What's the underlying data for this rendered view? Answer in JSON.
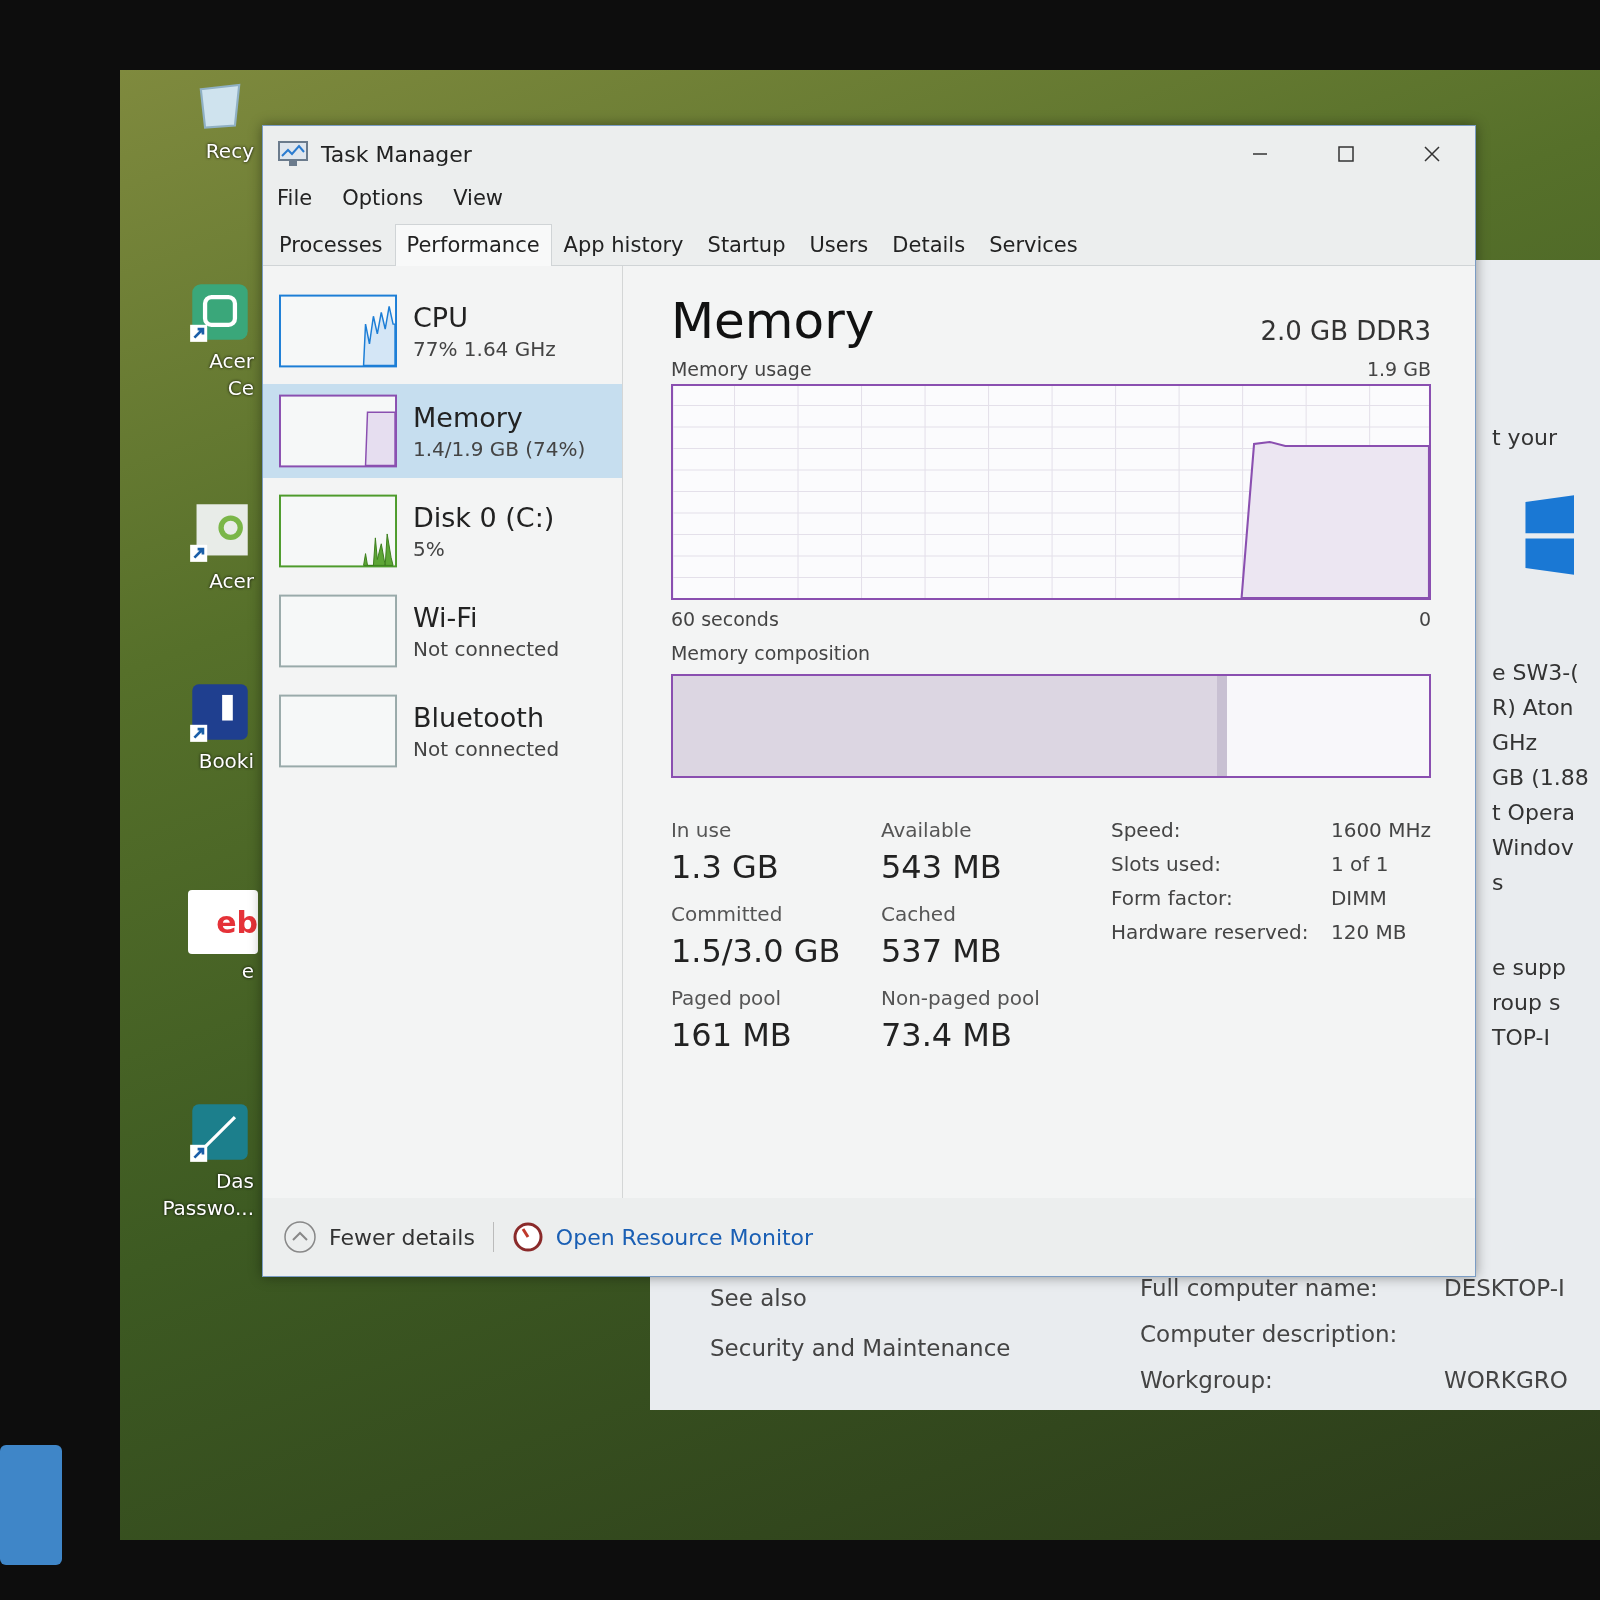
{
  "desktop_icons": [
    {
      "kind": "recycle",
      "lines": [
        "Recy"
      ]
    },
    {
      "kind": "care",
      "lines": [
        "Acer",
        "Ce"
      ]
    },
    {
      "kind": "acer",
      "lines": [
        "Acer"
      ]
    },
    {
      "kind": "booking",
      "lines": [
        "Booki"
      ]
    },
    {
      "kind": "ebay",
      "logo": "eb",
      "lines": [
        "e"
      ]
    },
    {
      "kind": "dashlane",
      "lines": [
        "Das",
        "Passwo..."
      ]
    }
  ],
  "system_window": {
    "right_column": [
      [
        "t your"
      ],
      [
        "e SW3-(",
        "R) Aton",
        "GHz",
        "GB (1.88",
        "t Opera",
        "Windov",
        "s"
      ],
      [
        "e supp",
        "roup s",
        "TOP-I"
      ]
    ],
    "see_also": {
      "heading": "See also",
      "links": [
        "Security and Maintenance"
      ]
    },
    "computer_fields": [
      {
        "label": "Full computer name:",
        "value": "DESKTOP-I"
      },
      {
        "label": "Computer description:"
      },
      {
        "label": "Workgroup:",
        "value": "WORKGRO"
      }
    ]
  },
  "window": {
    "title": "Task Manager"
  },
  "menu": [
    "File",
    "Options",
    "View"
  ],
  "tabs": [
    {
      "label": "Processes",
      "selected": false
    },
    {
      "label": "Performance",
      "selected": true
    },
    {
      "label": "App history",
      "selected": false
    },
    {
      "label": "Startup",
      "selected": false
    },
    {
      "label": "Users",
      "selected": false
    },
    {
      "label": "Details",
      "selected": false
    },
    {
      "label": "Services",
      "selected": false
    }
  ],
  "sidebar": [
    {
      "kind": "cpu",
      "name": "CPU",
      "detail": "77%  1.64 GHz",
      "selected": false
    },
    {
      "kind": "memory",
      "name": "Memory",
      "detail": "1.4/1.9 GB (74%)",
      "selected": true
    },
    {
      "kind": "disk",
      "name": "Disk 0 (C:)",
      "detail": "5%",
      "selected": false
    },
    {
      "kind": "empty",
      "name": "Wi-Fi",
      "detail": "Not connected",
      "selected": false
    },
    {
      "kind": "empty",
      "name": "Bluetooth",
      "detail": "Not connected",
      "selected": false
    }
  ],
  "main": {
    "title": "Memory",
    "spec": "2.0 GB DDR3",
    "usage_label": "Memory usage",
    "usage_max": "1.9 GB",
    "time_label": "60 seconds",
    "time_end": "0",
    "composition_label": "Memory composition",
    "composition": {
      "level": 0.72
    },
    "stats": [
      {
        "label": "In use",
        "value": "1.3 GB"
      },
      {
        "label": "Available",
        "value": "543 MB"
      },
      {
        "label": "Committed",
        "value": "1.5/3.0 GB"
      },
      {
        "label": "Cached",
        "value": "537 MB"
      },
      {
        "label": "Paged pool",
        "value": "161 MB"
      },
      {
        "label": "Non-paged pool",
        "value": "73.4 MB"
      }
    ],
    "properties": [
      {
        "label": "Speed:",
        "value": "1600 MHz"
      },
      {
        "label": "Slots used:",
        "value": "1 of 1"
      },
      {
        "label": "Form factor:",
        "value": "DIMM"
      },
      {
        "label": "Hardware reserved:",
        "value": "120 MB"
      }
    ]
  },
  "footer": {
    "fewer_details": "Fewer details",
    "resource_monitor": "Open Resource Monitor"
  }
}
